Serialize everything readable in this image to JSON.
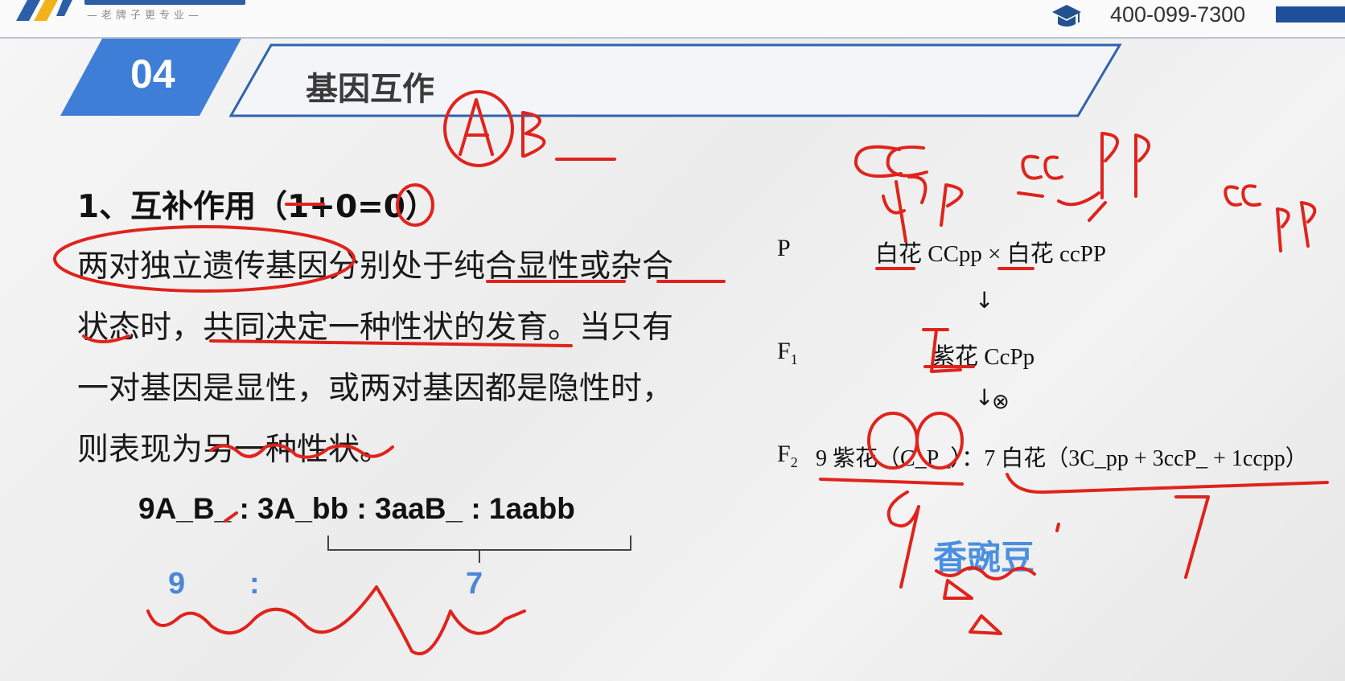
{
  "header": {
    "slogan": "—老牌子更专业—",
    "phone": "400-099-7300",
    "colors": {
      "brand_blue": "#2c5fa8",
      "accent_blue": "#3e7ed6",
      "annotation_red": "#e0231c"
    }
  },
  "slide": {
    "section_number": "04",
    "title": "基因互作",
    "heading": "1、互补作用（1+0=0）",
    "paragraph_lines": [
      "两对独立遗传基因分别处于纯合显性或杂合",
      "状态时，共同决定一种性状的发育。当只有",
      "一对基因是显性，或两对基因都是隐性时，",
      "则表现为另一种性状。"
    ],
    "ratio_line": "9A_B_ : 3A_bb : 3aaB_ : 1aabb",
    "summary": {
      "left": "9",
      "colon": ":",
      "right": "7"
    }
  },
  "diagram": {
    "p_label": "P",
    "f1_label": "F",
    "f1_sub": "1",
    "f2_label": "F",
    "f2_sub": "2",
    "cross": "白花 CCpp × 白花 ccPP",
    "down_arrow": "↓",
    "f1": "紫花 CcPp",
    "selfing": "⊗",
    "f2": "9 紫花（C_P_）：7 白花（3C_pp + 3ccP_ + 1ccpp）",
    "species": "香豌豆"
  },
  "annotations": {
    "top_note": "A B_",
    "cc_pp": "CCpp",
    "ccPP": "ccPP",
    "ccpp": "ccpp",
    "num_9": "9",
    "num_7": "7",
    "num_1": "1"
  }
}
